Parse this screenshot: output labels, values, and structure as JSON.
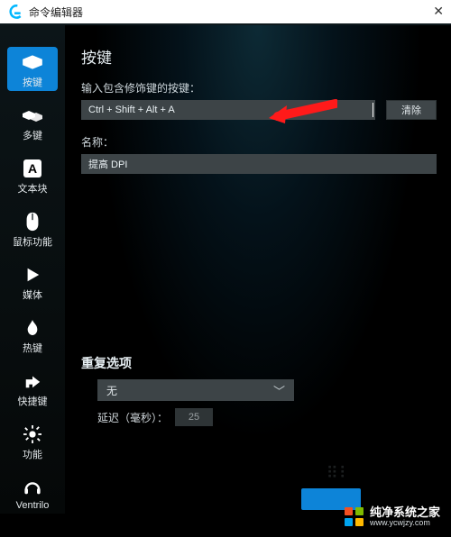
{
  "window": {
    "title": "命令编辑器",
    "close_glyph": "✕"
  },
  "sidebar": {
    "items": [
      {
        "label": "按键"
      },
      {
        "label": "多键"
      },
      {
        "label": "文本块"
      },
      {
        "label": "鼠标功能"
      },
      {
        "label": "媒体"
      },
      {
        "label": "热键"
      },
      {
        "label": "快捷键"
      },
      {
        "label": "功能"
      },
      {
        "label": "Ventrilo"
      }
    ]
  },
  "page": {
    "title": "按键",
    "key_label": "输入包含修饰键的按键：",
    "key_value": "Ctrl + Shift + Alt + A",
    "clear_btn": "清除",
    "name_label": "名称：",
    "name_value": "提高 DPI",
    "repeat_title": "重复选项",
    "repeat_value": "无",
    "delay_label": "延迟（毫秒）：",
    "delay_value": "25"
  },
  "watermark": {
    "line1": "纯净系统之家",
    "line2": "www.ycwjzy.com"
  },
  "colors": {
    "accent": "#0d84d8"
  }
}
